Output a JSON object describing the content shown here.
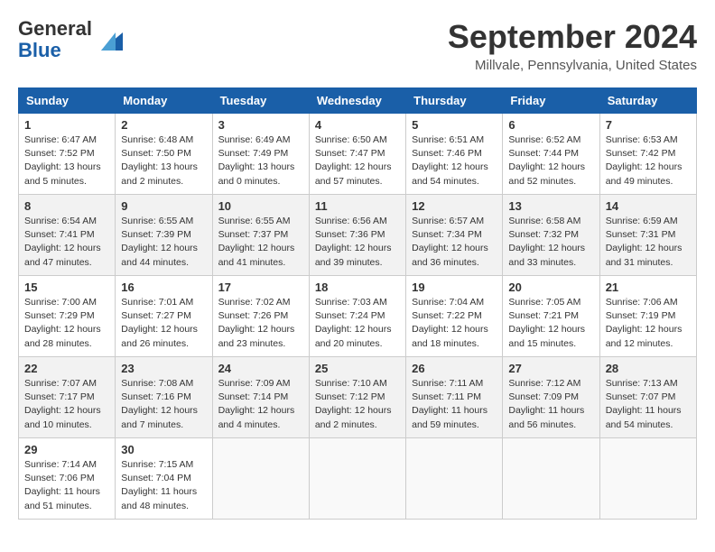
{
  "header": {
    "logo_line1": "General",
    "logo_line2": "Blue",
    "month": "September 2024",
    "location": "Millvale, Pennsylvania, United States"
  },
  "weekdays": [
    "Sunday",
    "Monday",
    "Tuesday",
    "Wednesday",
    "Thursday",
    "Friday",
    "Saturday"
  ],
  "weeks": [
    [
      {
        "day": "1",
        "sunrise": "6:47 AM",
        "sunset": "7:52 PM",
        "daylight": "13 hours and 5 minutes."
      },
      {
        "day": "2",
        "sunrise": "6:48 AM",
        "sunset": "7:50 PM",
        "daylight": "13 hours and 2 minutes."
      },
      {
        "day": "3",
        "sunrise": "6:49 AM",
        "sunset": "7:49 PM",
        "daylight": "13 hours and 0 minutes."
      },
      {
        "day": "4",
        "sunrise": "6:50 AM",
        "sunset": "7:47 PM",
        "daylight": "12 hours and 57 minutes."
      },
      {
        "day": "5",
        "sunrise": "6:51 AM",
        "sunset": "7:46 PM",
        "daylight": "12 hours and 54 minutes."
      },
      {
        "day": "6",
        "sunrise": "6:52 AM",
        "sunset": "7:44 PM",
        "daylight": "12 hours and 52 minutes."
      },
      {
        "day": "7",
        "sunrise": "6:53 AM",
        "sunset": "7:42 PM",
        "daylight": "12 hours and 49 minutes."
      }
    ],
    [
      {
        "day": "8",
        "sunrise": "6:54 AM",
        "sunset": "7:41 PM",
        "daylight": "12 hours and 47 minutes."
      },
      {
        "day": "9",
        "sunrise": "6:55 AM",
        "sunset": "7:39 PM",
        "daylight": "12 hours and 44 minutes."
      },
      {
        "day": "10",
        "sunrise": "6:55 AM",
        "sunset": "7:37 PM",
        "daylight": "12 hours and 41 minutes."
      },
      {
        "day": "11",
        "sunrise": "6:56 AM",
        "sunset": "7:36 PM",
        "daylight": "12 hours and 39 minutes."
      },
      {
        "day": "12",
        "sunrise": "6:57 AM",
        "sunset": "7:34 PM",
        "daylight": "12 hours and 36 minutes."
      },
      {
        "day": "13",
        "sunrise": "6:58 AM",
        "sunset": "7:32 PM",
        "daylight": "12 hours and 33 minutes."
      },
      {
        "day": "14",
        "sunrise": "6:59 AM",
        "sunset": "7:31 PM",
        "daylight": "12 hours and 31 minutes."
      }
    ],
    [
      {
        "day": "15",
        "sunrise": "7:00 AM",
        "sunset": "7:29 PM",
        "daylight": "12 hours and 28 minutes."
      },
      {
        "day": "16",
        "sunrise": "7:01 AM",
        "sunset": "7:27 PM",
        "daylight": "12 hours and 26 minutes."
      },
      {
        "day": "17",
        "sunrise": "7:02 AM",
        "sunset": "7:26 PM",
        "daylight": "12 hours and 23 minutes."
      },
      {
        "day": "18",
        "sunrise": "7:03 AM",
        "sunset": "7:24 PM",
        "daylight": "12 hours and 20 minutes."
      },
      {
        "day": "19",
        "sunrise": "7:04 AM",
        "sunset": "7:22 PM",
        "daylight": "12 hours and 18 minutes."
      },
      {
        "day": "20",
        "sunrise": "7:05 AM",
        "sunset": "7:21 PM",
        "daylight": "12 hours and 15 minutes."
      },
      {
        "day": "21",
        "sunrise": "7:06 AM",
        "sunset": "7:19 PM",
        "daylight": "12 hours and 12 minutes."
      }
    ],
    [
      {
        "day": "22",
        "sunrise": "7:07 AM",
        "sunset": "7:17 PM",
        "daylight": "12 hours and 10 minutes."
      },
      {
        "day": "23",
        "sunrise": "7:08 AM",
        "sunset": "7:16 PM",
        "daylight": "12 hours and 7 minutes."
      },
      {
        "day": "24",
        "sunrise": "7:09 AM",
        "sunset": "7:14 PM",
        "daylight": "12 hours and 4 minutes."
      },
      {
        "day": "25",
        "sunrise": "7:10 AM",
        "sunset": "7:12 PM",
        "daylight": "12 hours and 2 minutes."
      },
      {
        "day": "26",
        "sunrise": "7:11 AM",
        "sunset": "7:11 PM",
        "daylight": "11 hours and 59 minutes."
      },
      {
        "day": "27",
        "sunrise": "7:12 AM",
        "sunset": "7:09 PM",
        "daylight": "11 hours and 56 minutes."
      },
      {
        "day": "28",
        "sunrise": "7:13 AM",
        "sunset": "7:07 PM",
        "daylight": "11 hours and 54 minutes."
      }
    ],
    [
      {
        "day": "29",
        "sunrise": "7:14 AM",
        "sunset": "7:06 PM",
        "daylight": "11 hours and 51 minutes."
      },
      {
        "day": "30",
        "sunrise": "7:15 AM",
        "sunset": "7:04 PM",
        "daylight": "11 hours and 48 minutes."
      },
      null,
      null,
      null,
      null,
      null
    ]
  ],
  "labels": {
    "sunrise_prefix": "Sunrise: ",
    "sunset_prefix": "Sunset: ",
    "daylight_prefix": "Daylight: "
  }
}
